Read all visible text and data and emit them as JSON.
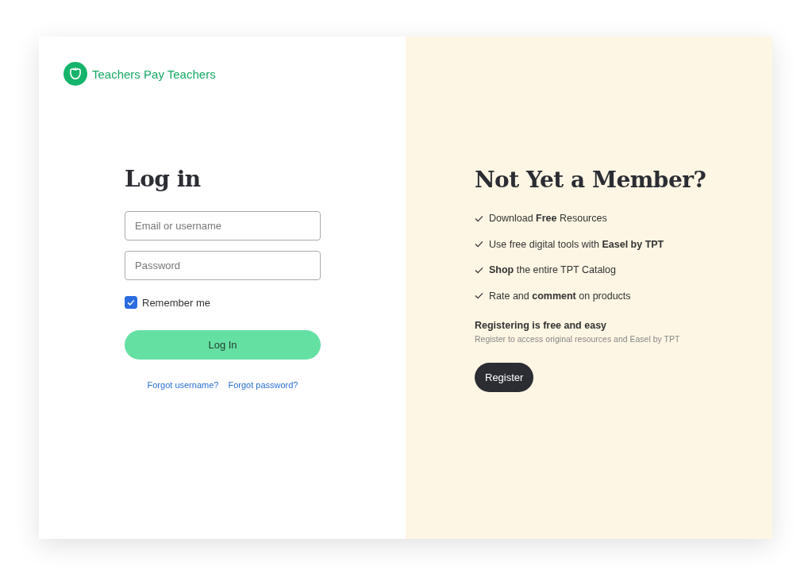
{
  "logo": {
    "text": "Teachers Pay Teachers"
  },
  "login": {
    "title": "Log in",
    "email": {
      "placeholder": "Email or username"
    },
    "password": {
      "placeholder": "Password"
    },
    "remember": {
      "label": "Remember me",
      "checked": true
    },
    "submit": "Log In",
    "links": [
      "Forgot username?",
      "Forgot password?"
    ]
  },
  "register": {
    "title": "Not Yet a Member?",
    "benefits": [
      "Download **Free** Resources",
      "Use free digital tools with **Easel by TPT**",
      "**Shop** the entire TPT Catalog",
      "Rate and **comment** on products"
    ],
    "subtitle": "Registering is free and easy",
    "note": "Register to access original resources and Easel by TPT",
    "button": "Register"
  }
}
